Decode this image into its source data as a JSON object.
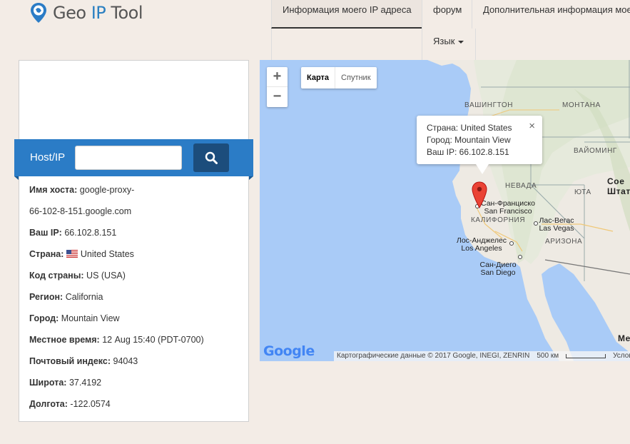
{
  "brand": {
    "part1": "Geo",
    "part2": "IP",
    "part3": "Tool"
  },
  "nav": {
    "items": [
      {
        "label": "Информация моего IP адреса"
      },
      {
        "label": "форум"
      },
      {
        "label": "Дополнительная информация моего IP адреса"
      }
    ],
    "language_label": "Язык"
  },
  "search": {
    "label": "Host/IP",
    "value": "",
    "placeholder": ""
  },
  "info": [
    {
      "key": "Имя хоста:",
      "value": "google-proxy-"
    },
    {
      "key": "",
      "value": "66-102-8-151.google.com"
    },
    {
      "key": "Ваш IP:",
      "value": "66.102.8.151"
    },
    {
      "key": "Страна:",
      "value": "United States",
      "flag": "us-flag-icon"
    },
    {
      "key": "Код страны:",
      "value": "US (USA)"
    },
    {
      "key": "Регион:",
      "value": "California"
    },
    {
      "key": "Город:",
      "value": "Mountain View"
    },
    {
      "key": "Местное время:",
      "value": "12 Aug 15:40 (PDT-0700)"
    },
    {
      "key": "Почтовый индекс:",
      "value": "94043"
    },
    {
      "key": "Широта:",
      "value": "37.4192"
    },
    {
      "key": "Долгота:",
      "value": "-122.0574"
    }
  ],
  "map": {
    "zoom_in": "+",
    "zoom_out": "−",
    "type_map": "Карта",
    "type_satellite": "Спутник",
    "popup": {
      "country": "Страна: United States",
      "city": "Город: Mountain View",
      "ip": "Ваш IP: 66.102.8.151",
      "close": "×"
    },
    "labels": {
      "washington": "ВАШИНГТОН",
      "montana": "МОНТАНА",
      "wyoming": "ВАЙОМИНГ",
      "nevada": "НЕВАДА",
      "utah": "ЮТА",
      "california": "КАЛИФОРНИЯ",
      "arizona": "АРИЗОНА",
      "usa": "Сое Штат",
      "me": "Ме"
    },
    "cities": {
      "sf": "Сан-Франциско San Francisco",
      "la": "Лос-Анджелес Los Angeles",
      "lv": "Лас-Вегас Las Vegas",
      "sd": "Сан-Диего San Diego"
    },
    "google_logo": "Google",
    "attribution": "Картографические данные © 2017 Google, INEGI, ZENRIN",
    "scale": "500 км",
    "terms": "Услов"
  },
  "colors": {
    "accent": "#2b7cc6",
    "button": "#1c4d7c",
    "water": "#a9cbf7",
    "land": "#f2efe9"
  }
}
